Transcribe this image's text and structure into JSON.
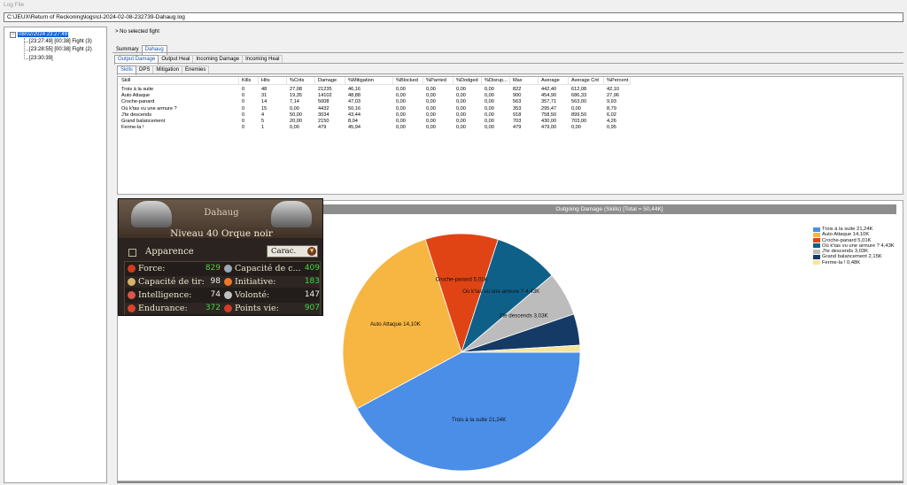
{
  "window": {
    "title": "Log File"
  },
  "log_path": "C:\\JEUX\\Return of Reckoning\\logs\\cl-2024-02-08-232739-Dahaug.log",
  "tree": {
    "root": "08/02/2024 23:27:49",
    "toggle": "−",
    "children": [
      "[23:27:49] [00:38] Fight (3)",
      "[23:28:55] [00:38] Fight (2)",
      "[23:30:39]"
    ]
  },
  "fight_label": "> No selected fight",
  "tabs_top": [
    "Summary",
    "Dahaug"
  ],
  "tabs_damage": [
    "Output Damage",
    "Output Heal",
    "Incoming Damage",
    "Incoming Heal"
  ],
  "tabs_sub": [
    "Skills",
    "DPS",
    "Mitigation",
    "Enemies"
  ],
  "table": {
    "columns": [
      "Skill",
      "Kills",
      "Hits",
      "%Crits",
      "Damage",
      "%Mitigation",
      "%Blocked",
      "%Parried",
      "%Dodged",
      "%Disrup...",
      "Max",
      "Average",
      "Average Crit",
      "%Percent"
    ],
    "rows": [
      [
        "Trois à la suite",
        "0",
        "48",
        "27,08",
        "21235",
        "46,16",
        "0,00",
        "0,00",
        "0,00",
        "0,00",
        "822",
        "442,40",
        "612,08",
        "42,10"
      ],
      [
        "Auto Attaque",
        "0",
        "31",
        "19,35",
        "14102",
        "48,88",
        "0,00",
        "0,00",
        "0,00",
        "0,00",
        "900",
        "454,90",
        "686,33",
        "27,96"
      ],
      [
        "Croche-panard",
        "0",
        "14",
        "7,14",
        "5008",
        "47,03",
        "0,00",
        "0,00",
        "0,00",
        "0,00",
        "563",
        "357,71",
        "563,00",
        "9,93"
      ],
      [
        "Où k'tas vu une armure ?",
        "0",
        "15",
        "0,00",
        "4432",
        "50,16",
        "0,00",
        "0,00",
        "0,00",
        "0,00",
        "353",
        "295,47",
        "0,00",
        "8,79"
      ],
      [
        "J'te descends",
        "0",
        "4",
        "50,00",
        "3034",
        "43,44",
        "0,00",
        "0,00",
        "0,00",
        "0,00",
        "918",
        "758,50",
        "899,50",
        "6,02"
      ],
      [
        "Grand balancement",
        "0",
        "5",
        "20,00",
        "2150",
        "8,04",
        "0,00",
        "0,00",
        "0,00",
        "0,00",
        "703",
        "430,00",
        "703,00",
        "4,26"
      ],
      [
        "Ferme-la !",
        "0",
        "1",
        "0,00",
        "479",
        "45,94",
        "0,00",
        "0,00",
        "0,00",
        "0,00",
        "479",
        "479,00",
        "0,00",
        "0,95"
      ]
    ]
  },
  "character": {
    "name": "Dahaug",
    "level": "Niveau 40 Orque noir",
    "appearance": "Apparence",
    "select": "Carac.",
    "stats": [
      {
        "label": "Force:",
        "value": "829",
        "color": "green",
        "icon": "fist-icon",
        "ico_color": "#d23a1d"
      },
      {
        "label": "Capacité de c...",
        "value": "409",
        "color": "green",
        "icon": "swords-icon",
        "ico_color": "#9aa7b5"
      },
      {
        "label": "Capacité de tir:",
        "value": "98",
        "color": "white",
        "icon": "bow-icon",
        "ico_color": "#d6b36a"
      },
      {
        "label": "Initiative:",
        "value": "183",
        "color": "green",
        "icon": "sparkle-icon",
        "ico_color": "#f07828"
      },
      {
        "label": "Intelligence:",
        "value": "74",
        "color": "white",
        "icon": "eye-icon",
        "ico_color": "#d8574a"
      },
      {
        "label": "Volonté:",
        "value": "147",
        "color": "white",
        "icon": "will-icon",
        "ico_color": "#c0c0c0"
      },
      {
        "label": "Endurance:",
        "value": "372",
        "color": "green",
        "icon": "heart-icon",
        "ico_color": "#d8452a"
      },
      {
        "label": "Points vie:",
        "value": "907",
        "color": "green",
        "icon": "health-icon",
        "ico_color": "#d33c28"
      }
    ]
  },
  "chart_data": {
    "type": "pie",
    "title": "Outgoing Damage (Skills) [Total = 50,44K]",
    "legend_position": "right",
    "slices": [
      {
        "label": "Trois à la suite",
        "value": 21.24,
        "legend": "Trois à la suite 21,24K",
        "pie_label": "Trois à la suite 21,24K",
        "color": "#4a8ee8"
      },
      {
        "label": "Auto Attaque",
        "value": 14.1,
        "legend": "Auto Attaque 14,10K",
        "pie_label": "Auto Attaque 14,10K",
        "color": "#f7b541"
      },
      {
        "label": "Croche-panard",
        "value": 5.01,
        "legend": "Croche-panard 5,01K",
        "pie_label": "Croche-panard 5,01K",
        "color": "#e04415"
      },
      {
        "label": "Où k'tas vu une armure ?",
        "value": 4.43,
        "legend": "Où k'tas vu une armure ? 4,43K",
        "pie_label": "Où k'tas vu une armure ? 4,43K",
        "color": "#0f6088"
      },
      {
        "label": "J'te descends",
        "value": 3.03,
        "legend": "J'te descends 3,03K",
        "pie_label": "J'te descends 3,03K",
        "color": "#bcbcbc"
      },
      {
        "label": "Grand balancement",
        "value": 2.15,
        "legend": "Grand balancement 2,15K",
        "pie_label": "",
        "color": "#163a66"
      },
      {
        "label": "Ferme-la !",
        "value": 0.48,
        "legend": "Ferme-la ! 0,48K",
        "pie_label": "",
        "color": "#f7e59a"
      }
    ]
  }
}
